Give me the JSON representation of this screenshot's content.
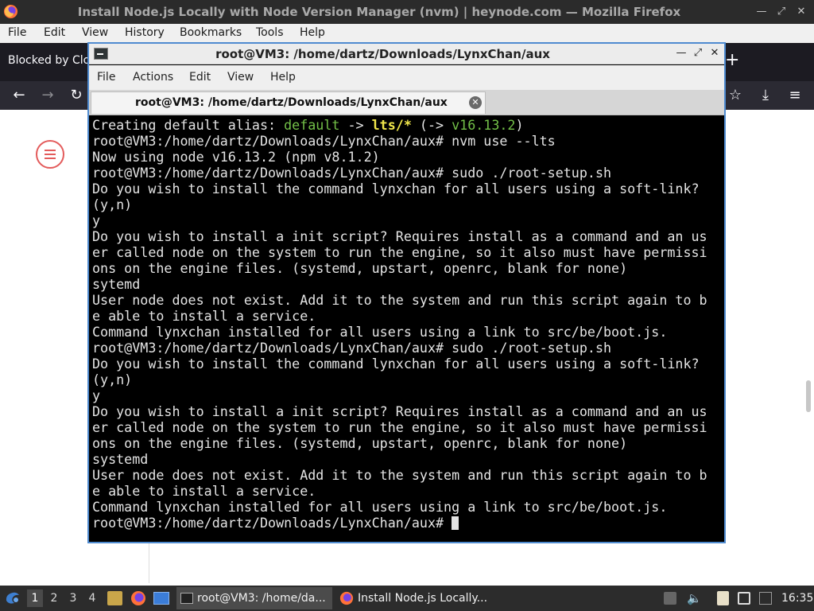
{
  "firefox": {
    "window_title": "Install Node.js Locally with Node Version Manager (nvm) | heynode.com — Mozilla Firefox",
    "menu": [
      "File",
      "Edit",
      "View",
      "History",
      "Bookmarks",
      "Tools",
      "Help"
    ],
    "tab_label_partial": "Blocked by Clo",
    "newtab_label": "+"
  },
  "terminal": {
    "title": "root@VM3: /home/dartz/Downloads/LynxChan/aux",
    "menu": [
      "File",
      "Actions",
      "Edit",
      "View",
      "Help"
    ],
    "tab_label": "root@VM3: /home/dartz/Downloads/LynxChan/aux",
    "lines": [
      {
        "parts": [
          {
            "t": "Creating default alias: "
          },
          {
            "t": "default",
            "c": "green"
          },
          {
            "t": " -> "
          },
          {
            "t": "lts/*",
            "c": "yellow"
          },
          {
            "t": " (-> "
          },
          {
            "t": "v16.13.2",
            "c": "green"
          },
          {
            "t": ")"
          }
        ]
      },
      {
        "parts": [
          {
            "t": "root@VM3:/home/dartz/Downloads/LynxChan/aux# nvm use --lts"
          }
        ]
      },
      {
        "parts": [
          {
            "t": "Now using node v16.13.2 (npm v8.1.2)"
          }
        ]
      },
      {
        "parts": [
          {
            "t": "root@VM3:/home/dartz/Downloads/LynxChan/aux# sudo ./root-setup.sh"
          }
        ]
      },
      {
        "parts": [
          {
            "t": "Do you wish to install the command lynxchan for all users using a soft-link?"
          }
        ]
      },
      {
        "parts": [
          {
            "t": "(y,n)"
          }
        ]
      },
      {
        "parts": [
          {
            "t": "y"
          }
        ]
      },
      {
        "parts": [
          {
            "t": "Do you wish to install a init script? Requires install as a command and an us"
          }
        ]
      },
      {
        "parts": [
          {
            "t": "er called node on the system to run the engine, so it also must have permissi"
          }
        ]
      },
      {
        "parts": [
          {
            "t": "ons on the engine files. (systemd, upstart, openrc, blank for none)"
          }
        ]
      },
      {
        "parts": [
          {
            "t": "sytemd"
          }
        ]
      },
      {
        "parts": [
          {
            "t": "User node does not exist. Add it to the system and run this script again to b"
          }
        ]
      },
      {
        "parts": [
          {
            "t": "e able to install a service."
          }
        ]
      },
      {
        "parts": [
          {
            "t": "Command lynxchan installed for all users using a link to src/be/boot.js."
          }
        ]
      },
      {
        "parts": [
          {
            "t": "root@VM3:/home/dartz/Downloads/LynxChan/aux# sudo ./root-setup.sh"
          }
        ]
      },
      {
        "parts": [
          {
            "t": "Do you wish to install the command lynxchan for all users using a soft-link?"
          }
        ]
      },
      {
        "parts": [
          {
            "t": "(y,n)"
          }
        ]
      },
      {
        "parts": [
          {
            "t": "y"
          }
        ]
      },
      {
        "parts": [
          {
            "t": "Do you wish to install a init script? Requires install as a command and an us"
          }
        ]
      },
      {
        "parts": [
          {
            "t": "er called node on the system to run the engine, so it also must have permissi"
          }
        ]
      },
      {
        "parts": [
          {
            "t": "ons on the engine files. (systemd, upstart, openrc, blank for none)"
          }
        ]
      },
      {
        "parts": [
          {
            "t": "systemd"
          }
        ]
      },
      {
        "parts": [
          {
            "t": "User node does not exist. Add it to the system and run this script again to b"
          }
        ]
      },
      {
        "parts": [
          {
            "t": "e able to install a service."
          }
        ]
      },
      {
        "parts": [
          {
            "t": "Command lynxchan installed for all users using a link to src/be/boot.js."
          }
        ]
      },
      {
        "parts": [
          {
            "t": "root@VM3:/home/dartz/Downloads/LynxChan/aux# "
          }
        ],
        "cursor": true
      }
    ],
    "colors": {
      "green": "#73c048",
      "yellow": "#f2e84b",
      "text": "#e4e4e4",
      "background": "#000000",
      "border": "#4f8bd0"
    }
  },
  "taskbar": {
    "workspaces": [
      "1",
      "2",
      "3",
      "4"
    ],
    "active_workspace": "1",
    "windows": [
      {
        "label": "root@VM3: /home/da...",
        "icon": "terminal-icon",
        "active": true
      },
      {
        "label": "Install Node.js Locally...",
        "icon": "firefox-icon",
        "active": false
      }
    ],
    "clock": "16:35"
  }
}
